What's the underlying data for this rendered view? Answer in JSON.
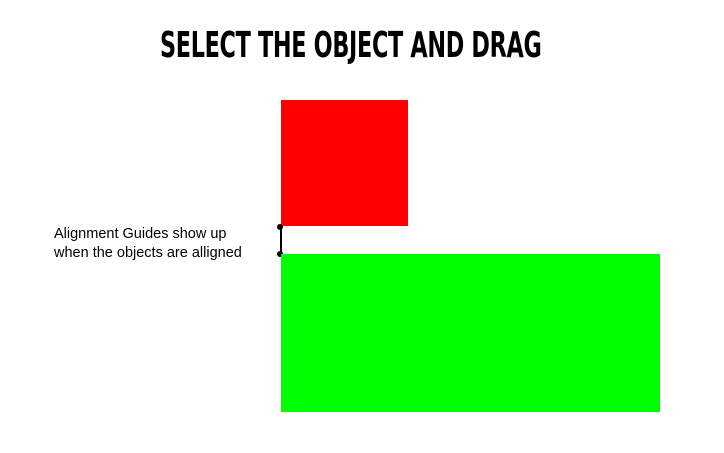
{
  "title": "Select the object and drag",
  "caption": {
    "line1": "Alignment Guides show up",
    "line2": "when the objects are alligned"
  },
  "colors": {
    "red_object": "#ff0000",
    "green_object": "#00ff00",
    "guide": "#000000"
  },
  "icons": {
    "guide_endpoint": "dot"
  }
}
